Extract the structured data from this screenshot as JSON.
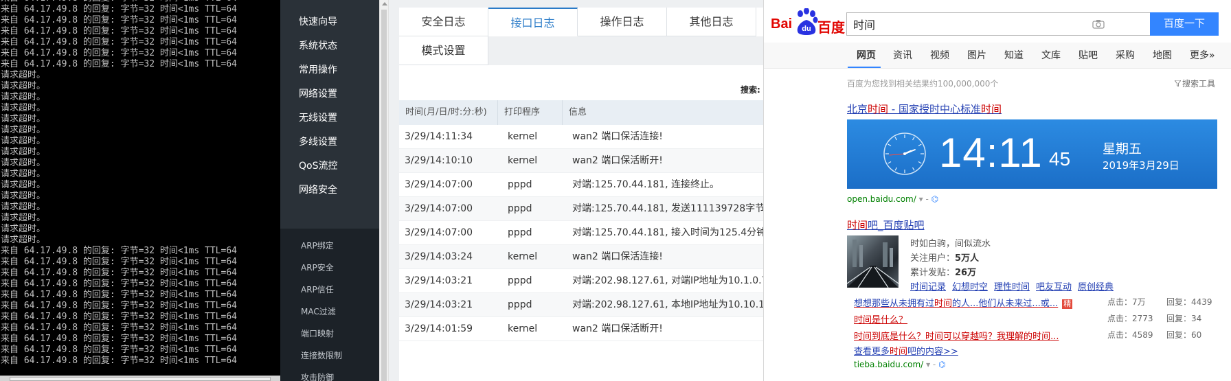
{
  "terminal": {
    "lines": [
      "来自 64.17.49.8 的回复: 字节=32 时间<1ms TTL=64",
      "来自 64.17.49.8 的回复: 字节=32 时间<1ms TTL=64",
      "来自 64.17.49.8 的回复: 字节=32 时间<1ms TTL=64",
      "来自 64.17.49.8 的回复: 字节=32 时间<1ms TTL=64",
      "来自 64.17.49.8 的回复: 字节=32 时间<1ms TTL=64",
      "来自 64.17.49.8 的回复: 字节=32 时间<1ms TTL=64",
      "来自 64.17.49.8 的回复: 字节=32 时间<1ms TTL=64",
      "请求超时。",
      "请求超时。",
      "请求超时。",
      "请求超时。",
      "请求超时。",
      "请求超时。",
      "请求超时。",
      "请求超时。",
      "请求超时。",
      "请求超时。",
      "请求超时。",
      "请求超时。",
      "请求超时。",
      "请求超时。",
      "请求超时。",
      "请求超时。",
      "来自 64.17.49.8 的回复: 字节=32 时间<1ms TTL=64",
      "来自 64.17.49.8 的回复: 字节=32 时间<1ms TTL=64",
      "来自 64.17.49.8 的回复: 字节=32 时间<1ms TTL=64",
      "来自 64.17.49.8 的回复: 字节=32 时间<1ms TTL=64",
      "来自 64.17.49.8 的回复: 字节=32 时间<1ms TTL=64",
      "来自 64.17.49.8 的回复: 字节=32 时间<1ms TTL=64",
      "来自 64.17.49.8 的回复: 字节=32 时间<1ms TTL=64",
      "来自 64.17.49.8 的回复: 字节=32 时间<1ms TTL=64",
      "来自 64.17.49.8 的回复: 字节=32 时间<1ms TTL=64",
      "来自 64.17.49.8 的回复: 字节=32 时间<1ms TTL=64",
      "来自 64.17.49.8 的回复: 字节=32 时间<1ms TTL=64"
    ]
  },
  "router": {
    "nav": {
      "main": [
        "快速向导",
        "系统状态",
        "常用操作",
        "网络设置",
        "无线设置",
        "多线设置",
        "QoS流控",
        "网络安全"
      ],
      "sub": [
        "ARP绑定",
        "ARP安全",
        "ARP信任",
        "MAC过滤",
        "端口映射",
        "连接数限制",
        "攻击防御"
      ]
    },
    "tabs": [
      "安全日志",
      "接口日志",
      "操作日志",
      "其他日志",
      "模式设置"
    ],
    "search_label": "搜索:",
    "table": {
      "headers": [
        "时间(月/日/时:分:秒)",
        "打印程序",
        "信息"
      ],
      "rows": [
        [
          "3/29/14:11:34",
          "kernel",
          "wan2 端口保活连接!"
        ],
        [
          "3/29/14:10:10",
          "kernel",
          "wan2 端口保活断开!"
        ],
        [
          "3/29/14:07:00",
          "pppd",
          "对端:125.70.44.181, 连接终止。"
        ],
        [
          "3/29/14:07:00",
          "pppd",
          "对端:125.70.44.181, 发送111139728字节, 接收"
        ],
        [
          "3/29/14:07:00",
          "pppd",
          "对端:125.70.44.181, 接入时间为125.4分钟。"
        ],
        [
          "3/29/14:03:24",
          "kernel",
          "wan2 端口保活连接!"
        ],
        [
          "3/29/14:03:21",
          "pppd",
          "对端:202.98.127.61, 对端IP地址为10.1.0.7"
        ],
        [
          "3/29/14:03:21",
          "pppd",
          "对端:202.98.127.61, 本地IP地址为10.10.10.10"
        ],
        [
          "3/29/14:01:59",
          "kernel",
          "wan2 端口保活断开!"
        ]
      ]
    }
  },
  "baidu": {
    "logo_a": "Bai",
    "logo_paw": "du",
    "logo_b": "百度",
    "search_value": "时间",
    "search_button": "百度一下",
    "tabs": [
      "网页",
      "资讯",
      "视频",
      "图片",
      "知道",
      "文库",
      "贴吧",
      "采购",
      "地图",
      "更多»"
    ],
    "result_count": "百度为您找到相关结果约100,000,000个",
    "tools": "搜索工具",
    "result1": {
      "title_parts": [
        "北京",
        "时间",
        " - 国家授时中心标准",
        "时间"
      ],
      "time": "14:11",
      "seconds": "45",
      "weekday": "星期五",
      "date": "2019年3月29日",
      "url": "open.baidu.com/"
    },
    "result2": {
      "title_parts": [
        "时间",
        "吧_百度贴吧"
      ],
      "desc": "时如白驹，间似流水",
      "followers_label": "关注用户：",
      "followers": "5万人",
      "posts_label": "累计发贴：",
      "posts": "26万",
      "links": [
        "时间记录",
        "幻想时空",
        "理性时间",
        "吧友互动",
        "原创经典"
      ],
      "threads": [
        {
          "parts": [
            "想想那些从未拥有过",
            "时间",
            "的人...他们从未来过...或..."
          ],
          "jing": "精",
          "clicks": "点击：7万",
          "replies": "回复：4439"
        },
        {
          "parts": [
            "时间",
            "是什么？"
          ],
          "clicks": "点击：2773",
          "replies": "回复：34"
        },
        {
          "parts": [
            "时间",
            "到底是什么？",
            "时间",
            "可以穿越吗？我理解的",
            "时间",
            "..."
          ],
          "clicks": "点击：4589",
          "replies": "回复：60"
        }
      ],
      "more_parts": [
        "查看更多",
        "时间",
        "吧的内容>>"
      ],
      "url": "tieba.baidu.com/"
    },
    "url_suffix": " - "
  }
}
